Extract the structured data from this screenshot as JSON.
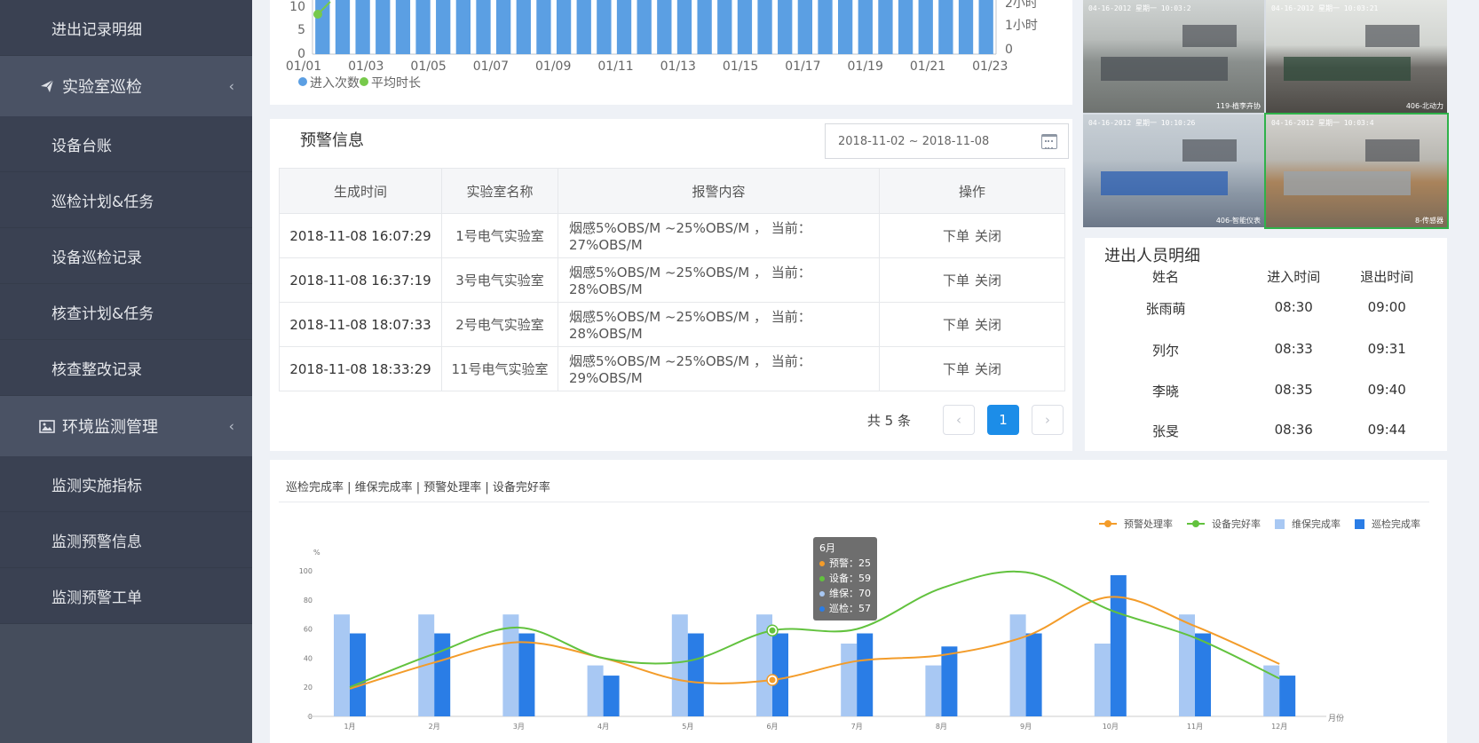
{
  "sidebar": {
    "items": [
      {
        "type": "item",
        "label": "进出记录明细"
      },
      {
        "type": "group",
        "label": "实验室巡检",
        "icon": "paper-plane-icon"
      },
      {
        "type": "item",
        "label": "设备台账"
      },
      {
        "type": "item",
        "label": "巡检计划&任务"
      },
      {
        "type": "item",
        "label": "设备巡检记录"
      },
      {
        "type": "item",
        "label": "核查计划&任务"
      },
      {
        "type": "item",
        "label": "核查整改记录"
      },
      {
        "type": "group",
        "label": "环境监测管理",
        "icon": "image-icon"
      },
      {
        "type": "item",
        "label": "监测实施指标"
      },
      {
        "type": "item",
        "label": "监测预警信息"
      },
      {
        "type": "item",
        "label": "监测预警工单"
      }
    ],
    "chevron": "‹"
  },
  "top_chart": {
    "legend": [
      "进入次数",
      "平均时长"
    ],
    "colors": {
      "bar": "#5b9fe3",
      "line": "#77c94b"
    },
    "left_ticks": [
      "10",
      "5",
      "0"
    ],
    "right_ticks": [
      "2小时",
      "1小时",
      "0"
    ],
    "x_labels": [
      "01/01",
      "01/03",
      "01/05",
      "01/07",
      "01/09",
      "01/11",
      "01/13",
      "01/15",
      "01/17",
      "01/19",
      "01/21",
      "01/23"
    ]
  },
  "video": {
    "cams": [
      {
        "stamp": "04-16-2012 星期一 10:03:2",
        "label": "119-植李卉协"
      },
      {
        "stamp": "04-16-2012 星期一 10:03:21",
        "label": "406-北动力"
      },
      {
        "stamp": "04-16-2012 星期一 10:10:26",
        "label": "406-智能仪表"
      },
      {
        "stamp": "04-16-2012 星期一 10:03:4",
        "label": "8-传感器"
      }
    ]
  },
  "warn": {
    "title": "预警信息",
    "date_range": "2018-11-02  ~  2018-11-08",
    "headers": [
      "生成时间",
      "实验室名称",
      "报警内容",
      "操作"
    ],
    "rows": [
      {
        "time": "2018-11-08 16:07:29",
        "lab": "1号电气实验室",
        "content": "烟感5%OBS/M  ~25%OBS/M  ，  当前：27%OBS/M",
        "op1": "下单",
        "op2": "关闭"
      },
      {
        "time": "2018-11-08 16:37:19",
        "lab": "3号电气实验室",
        "content": "烟感5%OBS/M  ~25%OBS/M  ，  当前：28%OBS/M",
        "op1": "下单",
        "op2": "关闭"
      },
      {
        "time": "2018-11-08 18:07:33",
        "lab": "2号电气实验室",
        "content": "烟感5%OBS/M  ~25%OBS/M  ，  当前：28%OBS/M",
        "op1": "下单",
        "op2": "关闭"
      },
      {
        "time": "2018-11-08 18:33:29",
        "lab": "11号电气实验室",
        "content": "烟感5%OBS/M  ~25%OBS/M  ，  当前：29%OBS/M",
        "op1": "下单",
        "op2": "关闭"
      }
    ],
    "pager": {
      "total": "共 5 条",
      "prev": "‹",
      "page": "1",
      "next": "›"
    }
  },
  "people": {
    "title": "进出人员明细",
    "headers": [
      "姓名",
      "进入时间",
      "退出时间"
    ],
    "rows": [
      {
        "name": "张雨萌",
        "in": "08:30",
        "out": "09:00"
      },
      {
        "name": "列尔",
        "in": "08:33",
        "out": "09:31"
      },
      {
        "name": "李晓",
        "in": "08:35",
        "out": "09:40"
      },
      {
        "name": "张旻",
        "in": "08:36",
        "out": "09:44"
      }
    ]
  },
  "bottom": {
    "title": "巡检完成率 | 维保完成率 | 预警处理率 | 设备完好率",
    "legend": [
      {
        "label": "预警处理率",
        "kind": "line",
        "color": "#f39c2a"
      },
      {
        "label": "设备完好率",
        "kind": "line",
        "color": "#62c23e"
      },
      {
        "label": "维保完成率",
        "kind": "box",
        "color": "#a8c8f3"
      },
      {
        "label": "巡检完成率",
        "kind": "box",
        "color": "#2a7de6"
      }
    ],
    "tooltip": {
      "title": "6月",
      "lines": [
        {
          "label": "预警：25",
          "color": "#f39c2a"
        },
        {
          "label": "设备：59",
          "color": "#62c23e"
        },
        {
          "label": "维保：70",
          "color": "#a8c8f3"
        },
        {
          "label": "巡检：57",
          "color": "#2a7de6"
        }
      ]
    }
  },
  "chart_data": {
    "type": "bar",
    "title": "巡检完成率 | 维保完成率 | 预警处理率 | 设备完好率",
    "categories": [
      "1月",
      "2月",
      "3月",
      "4月",
      "5月",
      "6月",
      "7月",
      "8月",
      "9月",
      "10月",
      "11月",
      "12月"
    ],
    "ylabel": "%",
    "xlabel": "月份",
    "ylim": [
      0,
      100
    ],
    "y_ticks": [
      "100",
      "80",
      "60",
      "40",
      "20",
      "0"
    ],
    "series": [
      {
        "name": "维保完成率",
        "kind": "bar",
        "color": "#a8c8f3",
        "values": [
          70,
          70,
          70,
          35,
          70,
          70,
          50,
          35,
          70,
          50,
          70,
          35
        ]
      },
      {
        "name": "巡检完成率",
        "kind": "bar",
        "color": "#2a7de6",
        "values": [
          57,
          57,
          57,
          28,
          57,
          57,
          57,
          48,
          57,
          97,
          57,
          28
        ]
      },
      {
        "name": "预警处理率",
        "kind": "line",
        "color": "#f39c2a",
        "values": [
          19,
          37,
          51,
          40,
          24,
          25,
          38,
          42,
          55,
          82,
          62,
          36
        ]
      },
      {
        "name": "设备完好率",
        "kind": "line",
        "color": "#62c23e",
        "values": [
          20,
          43,
          61,
          40,
          38,
          59,
          60,
          88,
          99,
          73,
          54,
          26
        ]
      }
    ]
  }
}
